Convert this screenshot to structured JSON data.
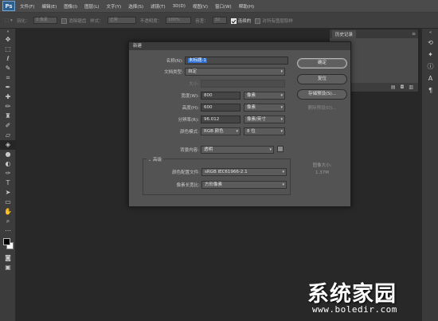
{
  "app": {
    "logo": "Ps"
  },
  "menu": [
    "文件(F)",
    "编辑(E)",
    "图像(I)",
    "图层(L)",
    "文字(Y)",
    "选择(S)",
    "滤镜(T)",
    "3D(D)",
    "视图(V)",
    "窗口(W)",
    "帮助(H)"
  ],
  "options": {
    "feather_label": "羽化：",
    "feather_value": "0 像素",
    "antialias_label": "消除锯齿",
    "style_label": "样式：",
    "style_value": "正常",
    "opacity_label": "不透明度：",
    "opacity_value": "100%",
    "width_label": "容差：",
    "width_value": "32",
    "contiguous_label": "连续的",
    "sample_all_label": "对所有图层取样"
  },
  "history_panel": {
    "tab": "历史记录"
  },
  "dialog": {
    "title": "新建",
    "name_label": "名称(N):",
    "name_value": "未标题-1",
    "preset_label": "文档类型:",
    "preset_value": "自定",
    "size_label": "大小:",
    "width_label": "宽度(W):",
    "width_value": "800",
    "width_unit": "像素",
    "height_label": "高度(H):",
    "height_value": "600",
    "height_unit": "像素",
    "resolution_label": "分辨率(R):",
    "resolution_value": "96.012",
    "resolution_unit": "像素/英寸",
    "color_mode_label": "颜色模式:",
    "color_mode_value": "RGB 颜色",
    "bit_depth_value": "8 位",
    "background_label": "背景内容:",
    "background_value": "透明",
    "advanced_label": "高级",
    "color_profile_label": "颜色配置文件:",
    "color_profile_value": "sRGB IEC61966-2.1",
    "pixel_aspect_label": "像素长宽比:",
    "pixel_aspect_value": "方形像素",
    "ok_button": "确定",
    "reset_button": "复位",
    "save_preset_button": "存储预设(S)...",
    "delete_preset_button": "删除预设(D)...",
    "image_size_label": "图像大小:",
    "image_size_value": "1.37M"
  },
  "watermark": {
    "cn": "系统家园",
    "url": "www.boledir.com"
  }
}
